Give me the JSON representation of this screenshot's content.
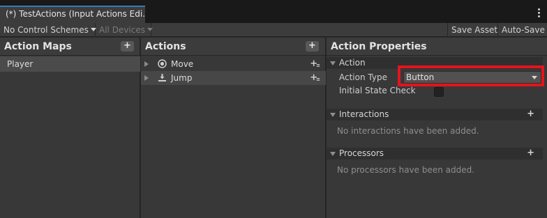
{
  "window": {
    "tab_title": "(*) TestActions (Input Actions Edi..."
  },
  "toolbar": {
    "control_schemes": "No Control Schemes",
    "devices": "All Devices",
    "save_asset": "Save Asset",
    "auto_save": "Auto-Save"
  },
  "action_maps": {
    "title": "Action Maps",
    "add_label": "+",
    "items": [
      "Player"
    ]
  },
  "actions": {
    "title": "Actions",
    "add_label": "+",
    "items": [
      {
        "label": "Move",
        "icon": "joystick-icon"
      },
      {
        "label": "Jump",
        "icon": "button-press-icon"
      }
    ]
  },
  "properties": {
    "title": "Action Properties",
    "action_section": "Action",
    "action_type_label": "Action Type",
    "action_type_value": "Button",
    "initial_state_label": "Initial State Check",
    "interactions_section": "Interactions",
    "interactions_empty": "No interactions have been added.",
    "processors_section": "Processors",
    "processors_empty": "No processors have been added.",
    "plus": "+"
  },
  "colors": {
    "tab_accent": "#3a79bb",
    "highlight": "#e4141d"
  }
}
